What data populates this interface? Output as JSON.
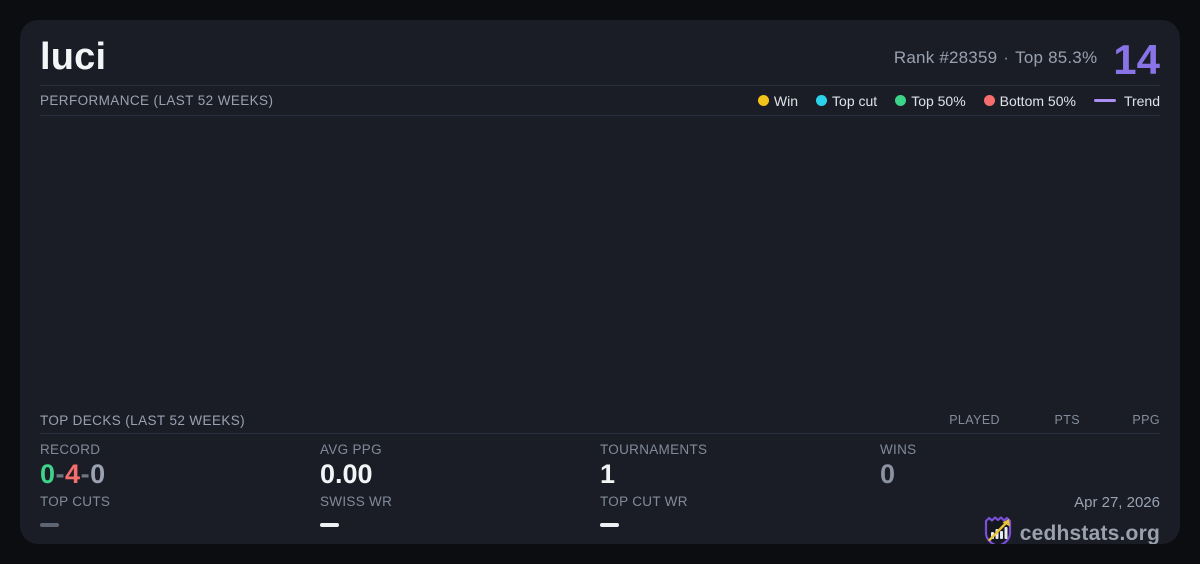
{
  "header": {
    "player_name": "luci",
    "rank_label": "Rank #28359",
    "dot_separator": "·",
    "top_percent_label": "Top 85.3%",
    "points": "14"
  },
  "performance": {
    "section_title": "PERFORMANCE (LAST 52 WEEKS)",
    "chart_empty": true,
    "legend": {
      "win": {
        "label": "Win",
        "color": "#f2c318"
      },
      "top_cut": {
        "label": "Top cut",
        "color": "#2bd2ec"
      },
      "top_50": {
        "label": "Top 50%",
        "color": "#3bd48a"
      },
      "bottom_50": {
        "label": "Bottom 50%",
        "color": "#f56d6d"
      },
      "trend": {
        "label": "Trend",
        "color": "#ab8ef2"
      }
    }
  },
  "top_decks": {
    "section_title": "TOP DECKS (LAST 52 WEEKS)",
    "columns": [
      "PLAYED",
      "PTS",
      "PPG"
    ],
    "rows": []
  },
  "stats": {
    "record": {
      "label": "RECORD",
      "wins": "0",
      "losses": "4",
      "draws": "0",
      "separator": "-"
    },
    "avg_ppg": {
      "label": "AVG PPG",
      "value": "0.00"
    },
    "tournaments": {
      "label": "TOURNAMENTS",
      "value": "1"
    },
    "wins": {
      "label": "WINS",
      "value": "0"
    },
    "top_cuts": {
      "label": "TOP CUTS",
      "value": "—"
    },
    "swiss_wr": {
      "label": "SWISS WR",
      "value": "—"
    },
    "top_cut_wr": {
      "label": "TOP CUT WR",
      "value": "—"
    }
  },
  "footer": {
    "date": "Apr 27, 2026",
    "brand": "cedhstats.org"
  },
  "colors": {
    "background": "#0c0d11",
    "card": "#1a1d26",
    "accent_purple": "#8973e6",
    "record_win_green": "#3ed48b",
    "record_loss_red": "#f66d6d",
    "muted_text": "#9aa2b1",
    "divider": "#2b3040"
  }
}
